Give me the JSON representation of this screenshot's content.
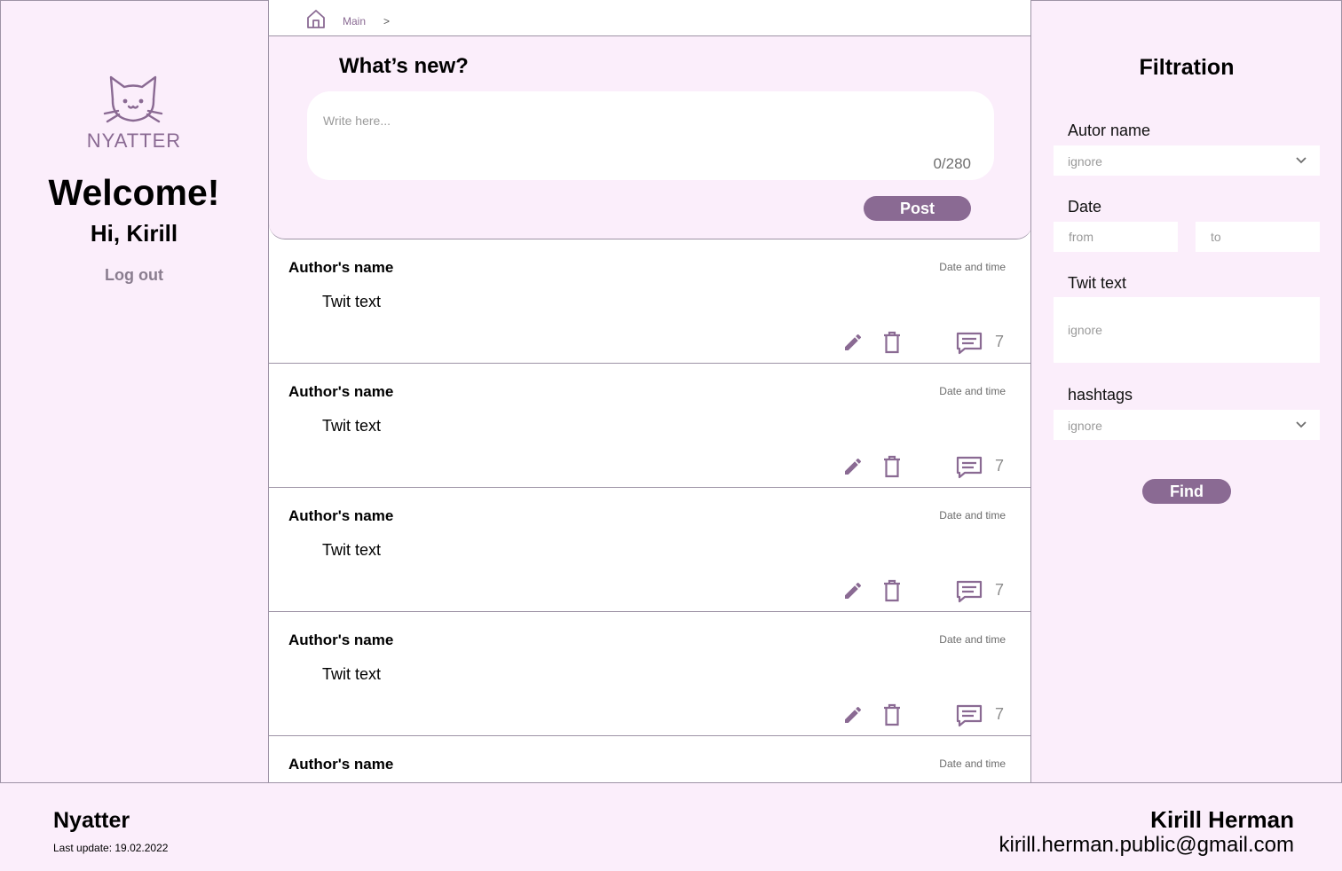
{
  "colors": {
    "accent": "#8a6a93",
    "background": "#fbeefb",
    "border": "#9e93a6"
  },
  "sidebar": {
    "logo_text": "NYATTER",
    "welcome": "Welcome!",
    "greeting": "Hi, Kirill",
    "logout": "Log out"
  },
  "breadcrumb": {
    "home_icon": "home-icon",
    "current": "Main",
    "separator": ">"
  },
  "composer": {
    "title": "What’s new?",
    "placeholder": "Write here...",
    "counter": "0/280",
    "post_label": "Post"
  },
  "tweets": [
    {
      "author": "Author's name",
      "date": "Date and time",
      "text": "Twit text",
      "comments": "7"
    },
    {
      "author": "Author's name",
      "date": "Date and time",
      "text": "Twit text",
      "comments": "7"
    },
    {
      "author": "Author's name",
      "date": "Date and time",
      "text": "Twit text",
      "comments": "7"
    },
    {
      "author": "Author's name",
      "date": "Date and time",
      "text": "Twit text",
      "comments": "7"
    },
    {
      "author": "Author's name",
      "date": "Date and time",
      "text": "",
      "comments": ""
    }
  ],
  "filter": {
    "title": "Filtration",
    "author_label": "Autor name",
    "author_value": "ignore",
    "date_label": "Date",
    "date_from_placeholder": "from",
    "date_to_placeholder": "to",
    "text_label": "Twit text",
    "text_placeholder": "ignore",
    "hashtags_label": "hashtags",
    "hashtags_value": "ignore",
    "find_label": "Find"
  },
  "footer": {
    "brand": "Nyatter",
    "last_update": "Last update: 19.02.2022",
    "author_name": "Kirill Herman",
    "email": "kirill.herman.public@gmail.com"
  }
}
